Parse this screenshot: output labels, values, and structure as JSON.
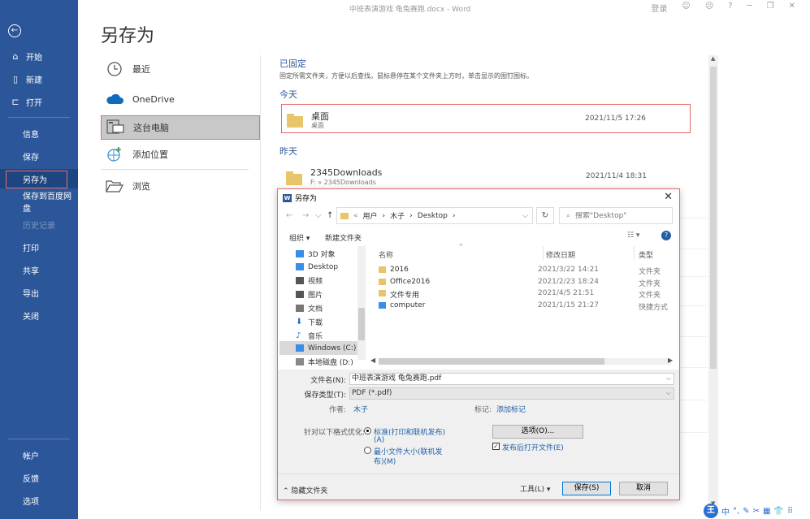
{
  "window": {
    "title": "中班表演游戏 龟兔赛跑.docx - Word",
    "login": "登录",
    "help": "?"
  },
  "sidebar": {
    "back_icon": "back-arrow-icon",
    "items": [
      {
        "label": "开始",
        "icon": "home-icon"
      },
      {
        "label": "新建",
        "icon": "new-doc-icon"
      },
      {
        "label": "打开",
        "icon": "open-folder-icon"
      },
      {
        "label": "信息"
      },
      {
        "label": "保存"
      },
      {
        "label": "另存为"
      },
      {
        "label": "保存到百度网盘"
      },
      {
        "label": "历史记录"
      },
      {
        "label": "打印"
      },
      {
        "label": "共享"
      },
      {
        "label": "导出"
      },
      {
        "label": "关闭"
      },
      {
        "label": "帐户"
      },
      {
        "label": "反馈"
      },
      {
        "label": "选项"
      }
    ]
  },
  "backstage": {
    "heading": "另存为",
    "locations": [
      {
        "label": "最近",
        "icon": "clock-icon"
      },
      {
        "label": "OneDrive",
        "icon": "cloud-icon"
      },
      {
        "label": "这台电脑",
        "icon": "computer-icon"
      },
      {
        "label": "添加位置",
        "icon": "globe-add-icon"
      },
      {
        "label": "浏览",
        "icon": "folder-open-icon"
      }
    ],
    "pinned": {
      "title": "已固定",
      "description": "固定所需文件夹，方便以后查找。鼠标悬停在某个文件夹上方时，单击显示的图钉图标。"
    },
    "today": {
      "title": "今天",
      "items": [
        {
          "name": "桌面",
          "path": "桌面",
          "date": "2021/11/5 17:26"
        }
      ]
    },
    "yesterday": {
      "title": "昨天",
      "items": [
        {
          "name": "2345Downloads",
          "path": "F: » 2345Downloads",
          "date": "2021/11/4 18:31"
        }
      ]
    }
  },
  "dialog": {
    "title": "另存为",
    "close": "✕",
    "breadcrumb": [
      "«",
      "用户",
      "›",
      "木子",
      "›",
      "Desktop",
      "›"
    ],
    "search_placeholder": "搜索\"Desktop\"",
    "toolbar": {
      "organize": "组织 ▾",
      "new_folder": "新建文件夹"
    },
    "tree": [
      {
        "label": "3D 对象",
        "color": "#3a8ee6"
      },
      {
        "label": "Desktop",
        "color": "#3a8ee6"
      },
      {
        "label": "视频",
        "color": "#555555"
      },
      {
        "label": "图片",
        "color": "#555555"
      },
      {
        "label": "文档",
        "color": "#777777"
      },
      {
        "label": "下载",
        "color": "#1f6fd1"
      },
      {
        "label": "音乐",
        "color": "#1f6fd1"
      },
      {
        "label": "Windows (C:)",
        "color": "#3a8ee6"
      },
      {
        "label": "本地磁盘 (D:)",
        "color": "#888888"
      }
    ],
    "columns": {
      "name": "名称",
      "date": "修改日期",
      "type": "类型"
    },
    "files": [
      {
        "name": "2016",
        "date": "2021/3/22 14:21",
        "type": "文件夹"
      },
      {
        "name": "Office2016",
        "date": "2021/2/23 18:24",
        "type": "文件夹"
      },
      {
        "name": "文件专用",
        "date": "2021/4/5 21:51",
        "type": "文件夹"
      },
      {
        "name": "computer",
        "date": "2021/1/15 21:27",
        "type": "快捷方式"
      }
    ],
    "form": {
      "filename_label": "文件名(N):",
      "filename_value": "中班表演游戏 龟兔赛跑.pdf",
      "filetype_label": "保存类型(T):",
      "filetype_value": "PDF (*.pdf)",
      "author_label": "作者:",
      "author_value": "木子",
      "tags_label": "标记:",
      "tags_value": "添加标记",
      "optimize_label": "针对以下格式优化:",
      "opt_standard": "标准(打印和联机发布)",
      "opt_standard_key": "(A)",
      "opt_min": "最小文件大小(联机发",
      "opt_min_key": "布)(M)",
      "options_button": "选项(O)...",
      "open_after_label": "发布后打开文件(E)",
      "hide_folders": "隐藏文件夹",
      "tools": "工具(L)",
      "save": "保存(S)",
      "cancel": "取消"
    }
  },
  "ime": {
    "logo": "王",
    "mode": "中"
  }
}
